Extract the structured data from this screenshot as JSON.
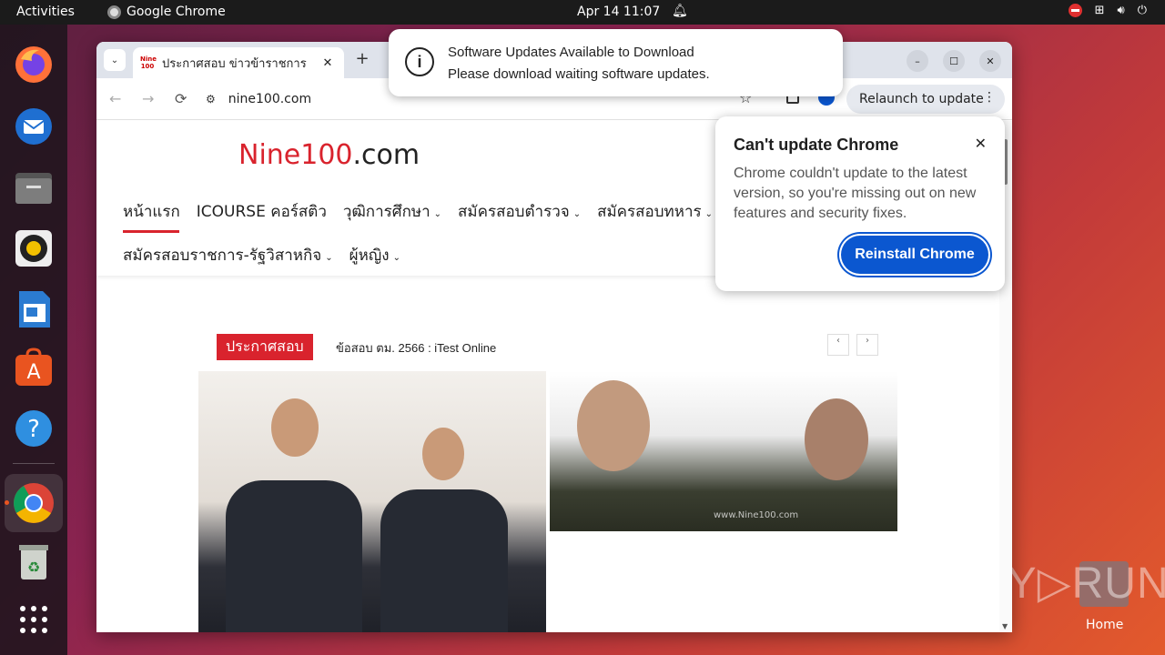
{
  "topbar": {
    "activities": "Activities",
    "app_name": "Google Chrome",
    "clock": "Apr 14  11:07"
  },
  "dock": {
    "items": [
      "firefox-icon",
      "thunderbird-icon",
      "files-icon",
      "rhythmbox-icon",
      "writer-icon",
      "app-center-icon",
      "help-icon",
      "chrome-icon",
      "trash-icon",
      "app-grid-icon"
    ]
  },
  "browser": {
    "tab_title": "ประกาศสอบ ข่าวข้าราชการ",
    "favicon_text": "Nine 100",
    "url": "nine100.com",
    "relaunch_label": "Relaunch to update"
  },
  "notification": {
    "line1": "Software Updates Available to Download",
    "line2": "Please download waiting software updates."
  },
  "bubble": {
    "title": "Can't update Chrome",
    "body": "Chrome couldn't update to the latest version, so you're missing out on new features and security fixes.",
    "button": "Reinstall Chrome"
  },
  "site": {
    "logo_red": "Nine100",
    "logo_dark": ".com",
    "nav_row1": [
      {
        "label": "หน้าแรก",
        "caret": ""
      },
      {
        "label": "ICOURSE คอร์สติว",
        "caret": ""
      },
      {
        "label": "วุฒิการศึกษา",
        "caret": "⌄"
      },
      {
        "label": "สมัครสอบตำรวจ",
        "caret": "⌄"
      },
      {
        "label": "สมัครสอบทหาร",
        "caret": "⌄"
      }
    ],
    "nav_row2": [
      {
        "label": "สมัครสอบราชการ-รัฐวิสาหกิจ",
        "caret": "⌄"
      },
      {
        "label": "ผู้หญิง",
        "caret": "⌄"
      }
    ],
    "news_label": "ประกาศสอบ",
    "news_text": "ข้อสอบ ตม. 2566 : iTest Online",
    "image_watermark": "www.Nine100.com"
  },
  "desktop": {
    "home_label": "Home",
    "watermark": "ANY▷RUN"
  }
}
